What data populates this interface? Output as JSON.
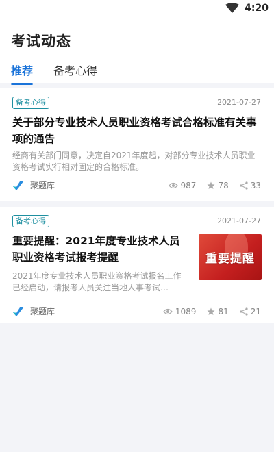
{
  "status": {
    "time": "4:20"
  },
  "page": {
    "title": "考试动态"
  },
  "tabs": [
    {
      "label": "推荐",
      "active": true
    },
    {
      "label": "备考心得",
      "active": false
    }
  ],
  "articles": [
    {
      "tag": "备考心得",
      "date": "2021-07-27",
      "title": "关于部分专业技术人员职业资格考试合格标准有关事项的通告",
      "summary": "经商有关部门同意，决定自2021年度起，对部分专业技术人员职业资格考试实行相对固定的合格标准。",
      "source": "聚题库",
      "views": "987",
      "likes": "78",
      "shares": "33"
    },
    {
      "tag": "备考心得",
      "date": "2021-07-27",
      "title": "重要提醒：2021年度专业技术人员职业资格考试报考提醒",
      "summary": "2021年度专业技术人员职业资格考试报名工作已经启动，请报考人员关注当地人事考试…",
      "source": "聚题库",
      "views": "1089",
      "likes": "81",
      "shares": "21",
      "thumb_text": "重要提醒"
    }
  ],
  "colors": {
    "accent": "#1a73d9",
    "tag": "#1e8fa0",
    "thumb": "#c41f1f"
  }
}
